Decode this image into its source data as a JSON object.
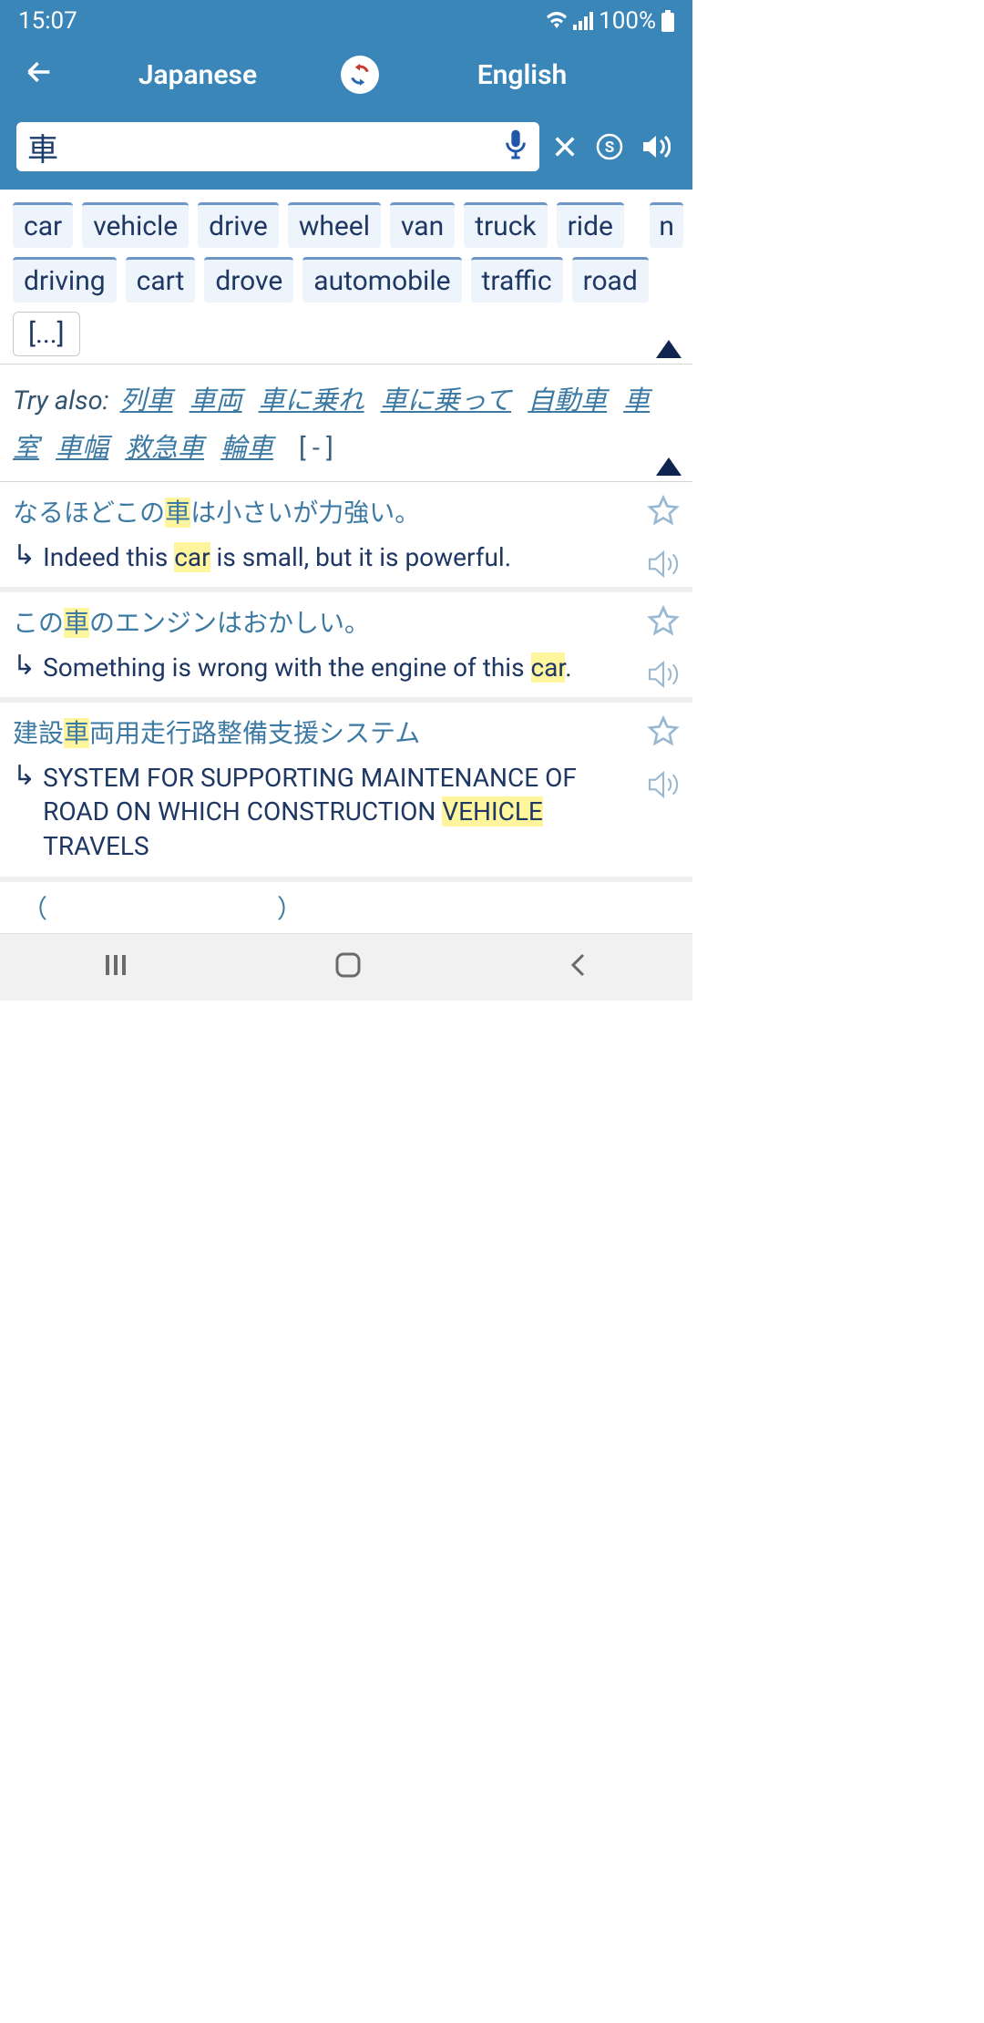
{
  "status": {
    "time": "15:07",
    "battery": "100%"
  },
  "header": {
    "lang_from": "Japanese",
    "lang_to": "English"
  },
  "search": {
    "value": "車"
  },
  "chips": [
    "car",
    "vehicle",
    "drive",
    "wheel",
    "van",
    "truck",
    "ride",
    "driving",
    "cart",
    "drove",
    "automobile",
    "traffic",
    "road"
  ],
  "chip_side": "n",
  "chip_more": "[...]",
  "tryalso": {
    "label": "Try also:",
    "links": [
      "列車",
      "車両",
      "車に乗れ",
      "車に乗って",
      "自動車",
      "車室",
      "車幅",
      "救急車",
      "輪車"
    ],
    "collapse": "[ - ]"
  },
  "examples": [
    {
      "jp_pre": "なるほどこの",
      "jp_hl": "車",
      "jp_post": "は小さいが力強い。",
      "en_pre": "Indeed this ",
      "en_hl": "car",
      "en_post": " is small, but it is powerful."
    },
    {
      "jp_pre": "この",
      "jp_hl": "車",
      "jp_post": "のエンジンはおかしい。",
      "en_pre": "Something is wrong with the engine of this ",
      "en_hl": "car",
      "en_post": "."
    },
    {
      "jp_pre": "建設",
      "jp_hl": "車",
      "jp_post": "両用走行路整備支援システム",
      "en_pre": "SYSTEM FOR SUPPORTING MAINTENANCE OF ROAD ON WHICH CONSTRUCTION ",
      "en_hl": "VEHICLE",
      "en_post": " TRAVELS"
    }
  ]
}
